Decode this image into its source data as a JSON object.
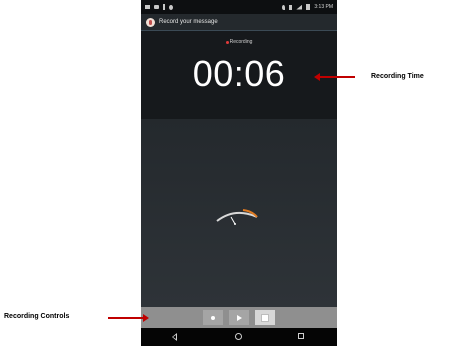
{
  "status_bar": {
    "time": "3:13 PM",
    "left_icons": [
      "notification-icon",
      "signal-icon",
      "download-icon",
      "sync-icon"
    ],
    "right_icons": [
      "location-icon",
      "bluetooth-icon",
      "wifi-icon",
      "battery-icon"
    ]
  },
  "app": {
    "title": "Record your message",
    "icon": "recorder-app-icon"
  },
  "recorder": {
    "status_text": "Recording",
    "status_dot_color": "#e03a3a",
    "elapsed_time": "00:06"
  },
  "controls": {
    "record_icon": "record-icon",
    "play_icon": "play-icon",
    "stop_icon": "stop-icon"
  },
  "nav_bar": {
    "back_icon": "back-icon",
    "home_icon": "home-icon",
    "recents_icon": "recents-icon"
  },
  "annotations": {
    "recording_time": "Recording Time",
    "recording_controls": "Recording Controls",
    "arrow_color": "#c00000"
  },
  "colors": {
    "meter_fg": "#e07b22",
    "meter_bg": "#d9d9d9"
  }
}
